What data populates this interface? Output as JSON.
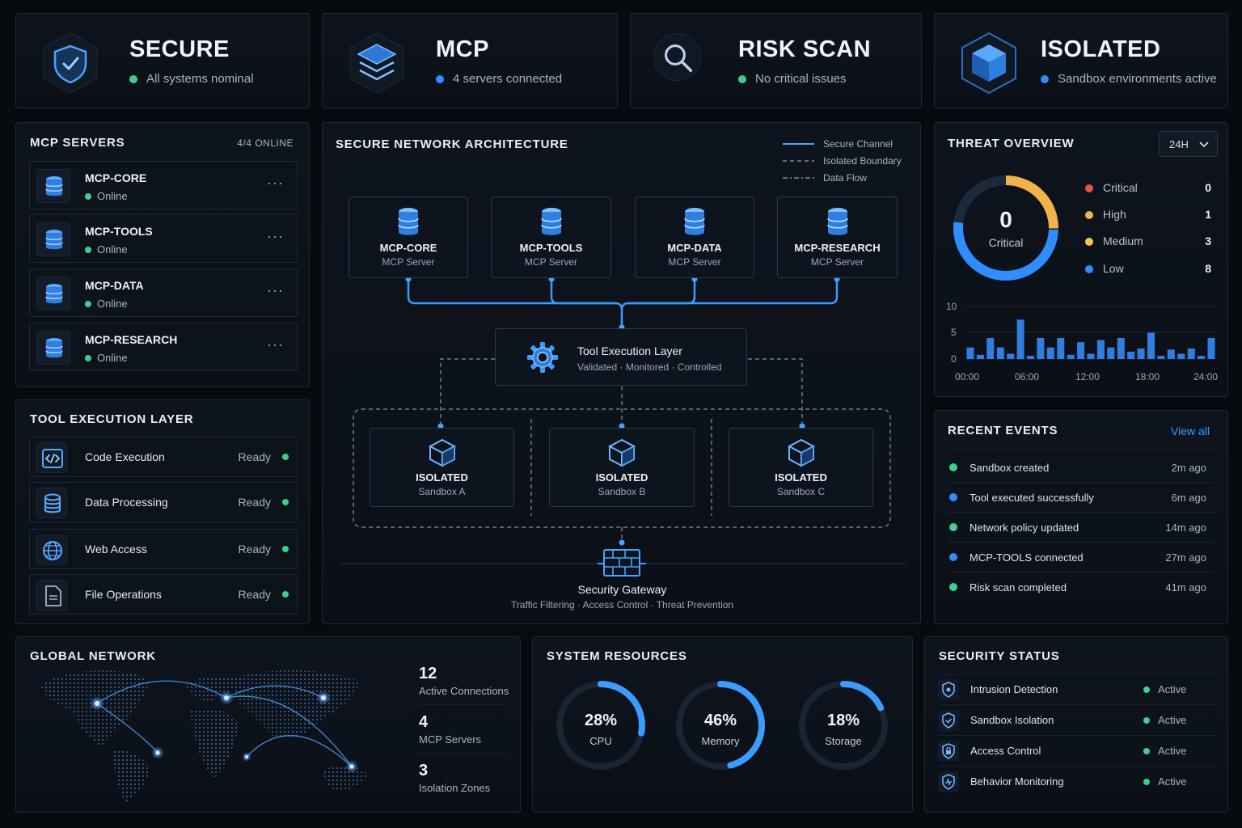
{
  "colors": {
    "green": "#3ecf8e",
    "blue": "#2f8dff",
    "orange": "#f0b24a",
    "yellow": "#f5c84a",
    "red": "#e5534b",
    "accent": "#3b9bff"
  },
  "status_cards": [
    {
      "title": "SECURE",
      "subtitle": "All systems nominal",
      "dot": "green",
      "icon": "shield-check-icon"
    },
    {
      "title": "MCP",
      "subtitle": "4 servers connected",
      "dot": "blue",
      "icon": "layers-icon"
    },
    {
      "title": "RISK SCAN",
      "subtitle": "No critical issues",
      "dot": "green",
      "icon": "search-icon"
    },
    {
      "title": "ISOLATED",
      "subtitle": "Sandbox environments active",
      "dot": "blue",
      "icon": "cube-icon"
    }
  ],
  "mcp_servers": {
    "title": "MCP SERVERS",
    "online": "4/4 ONLINE",
    "items": [
      {
        "name": "MCP-CORE",
        "status": "Online"
      },
      {
        "name": "MCP-TOOLS",
        "status": "Online"
      },
      {
        "name": "MCP-DATA",
        "status": "Online"
      },
      {
        "name": "MCP-RESEARCH",
        "status": "Online"
      }
    ]
  },
  "tool_layer": {
    "title": "TOOL EXECUTION LAYER",
    "items": [
      {
        "name": "Code Execution",
        "state": "Ready",
        "icon": "code-icon"
      },
      {
        "name": "Data Processing",
        "state": "Ready",
        "icon": "database-icon"
      },
      {
        "name": "Web Access",
        "state": "Ready",
        "icon": "globe-icon"
      },
      {
        "name": "File Operations",
        "state": "Ready",
        "icon": "file-icon"
      }
    ]
  },
  "architecture": {
    "title": "SECURE NETWORK ARCHITECTURE",
    "legend": [
      "Secure Channel",
      "Isolated Boundary",
      "Data Flow"
    ],
    "servers": [
      {
        "name": "MCP-CORE",
        "sub": "MCP Server"
      },
      {
        "name": "MCP-TOOLS",
        "sub": "MCP Server"
      },
      {
        "name": "MCP-DATA",
        "sub": "MCP Server"
      },
      {
        "name": "MCP-RESEARCH",
        "sub": "MCP Server"
      }
    ],
    "layer": {
      "name": "Tool Execution Layer",
      "sub": "Validated · Monitored · Controlled"
    },
    "sandboxes": [
      {
        "name": "ISOLATED",
        "sub": "Sandbox A"
      },
      {
        "name": "ISOLATED",
        "sub": "Sandbox B"
      },
      {
        "name": "ISOLATED",
        "sub": "Sandbox C"
      }
    ],
    "gateway": {
      "name": "Security Gateway",
      "sub": "Traffic Filtering · Access Control · Threat Prevention"
    }
  },
  "threat": {
    "title": "THREAT OVERVIEW",
    "range": "24H",
    "center_value": "0",
    "center_label": "Critical",
    "levels": [
      {
        "label": "Critical",
        "value": "0",
        "color": "red"
      },
      {
        "label": "High",
        "value": "1",
        "color": "orange"
      },
      {
        "label": "Medium",
        "value": "3",
        "color": "yellow"
      },
      {
        "label": "Low",
        "value": "8",
        "color": "blue"
      }
    ]
  },
  "chart_data": {
    "type": "bar",
    "yticks": [
      "10",
      "5",
      "0"
    ],
    "xticks": [
      "00:00",
      "06:00",
      "12:00",
      "18:00",
      "24:00"
    ],
    "ylim": [
      0,
      10
    ],
    "values": [
      2.2,
      0.8,
      4,
      2.2,
      1,
      7.5,
      0.6,
      4,
      2.2,
      4,
      0.8,
      3.2,
      1,
      3.6,
      2.2,
      4,
      1.4,
      2,
      5,
      0.6,
      1.8,
      1,
      2,
      0.6,
      4
    ]
  },
  "events": {
    "title": "RECENT EVENTS",
    "view_all": "View all",
    "items": [
      {
        "text": "Sandbox created",
        "time": "2m ago",
        "color": "green"
      },
      {
        "text": "Tool executed successfully",
        "time": "6m ago",
        "color": "blue"
      },
      {
        "text": "Network policy updated",
        "time": "14m ago",
        "color": "green"
      },
      {
        "text": "MCP-TOOLS connected",
        "time": "27m ago",
        "color": "blue"
      },
      {
        "text": "Risk scan completed",
        "time": "41m ago",
        "color": "green"
      }
    ]
  },
  "global": {
    "title": "GLOBAL NETWORK",
    "stats": [
      {
        "value": "12",
        "label": "Active Connections"
      },
      {
        "value": "4",
        "label": "MCP Servers"
      },
      {
        "value": "3",
        "label": "Isolation Zones"
      }
    ]
  },
  "resources": {
    "title": "SYSTEM RESOURCES",
    "items": [
      {
        "value": "28%",
        "label": "CPU",
        "fraction": 0.28
      },
      {
        "value": "46%",
        "label": "Memory",
        "fraction": 0.46
      },
      {
        "value": "18%",
        "label": "Storage",
        "fraction": 0.18
      }
    ]
  },
  "security": {
    "title": "SECURITY STATUS",
    "items": [
      {
        "name": "Intrusion Detection",
        "state": "Active"
      },
      {
        "name": "Sandbox Isolation",
        "state": "Active"
      },
      {
        "name": "Access Control",
        "state": "Active"
      },
      {
        "name": "Behavior Monitoring",
        "state": "Active"
      }
    ]
  }
}
